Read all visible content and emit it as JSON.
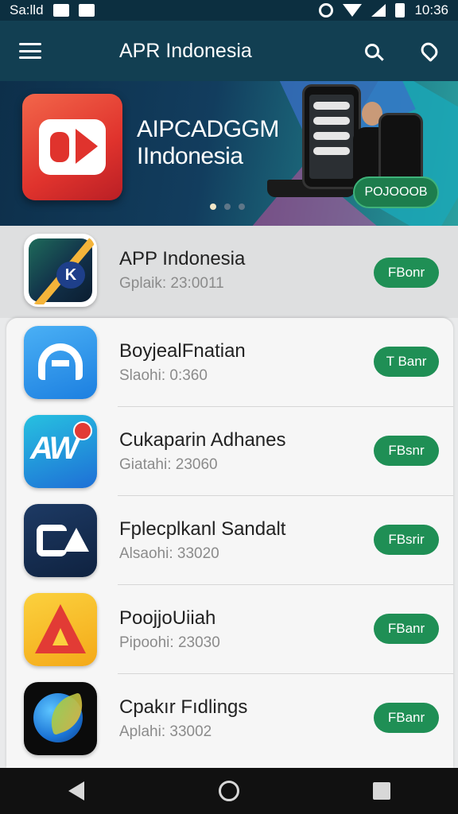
{
  "status_bar": {
    "carrier": "Sa:lld",
    "time": "10:36"
  },
  "app_bar": {
    "title": "APR Indonesia"
  },
  "banner": {
    "title_line1": "AIPCADGGM",
    "title_line2": "IIndonesia",
    "cta_label": "POJOOOB",
    "page_count": 3,
    "active_page": 1
  },
  "featured_app": {
    "name": "APP Indonesia",
    "meta": "Gplaik: 23:0011",
    "button": "FBonr"
  },
  "apps": [
    {
      "name": "BoyjealFnatian",
      "meta": "Slaohi: 0:360",
      "button": "T Banr"
    },
    {
      "name": "Cukaparin Adhanes",
      "meta": "Giatahi: 23060",
      "button": "FBsnr"
    },
    {
      "name": "Fplecplkanl Sandalt",
      "meta": "Alsaohi: 33020",
      "button": "FBsrir"
    },
    {
      "name": "PoojjoUiiah",
      "meta": "Pipoohi: 23030",
      "button": "FBanr"
    },
    {
      "name": "Cpakır Fıdlings",
      "meta": "Aplahi: 33002",
      "button": "FBanr"
    }
  ],
  "colors": {
    "app_bar": "#123f52",
    "get_button": "#1f8f55",
    "status_bar": "#0c2f40"
  }
}
